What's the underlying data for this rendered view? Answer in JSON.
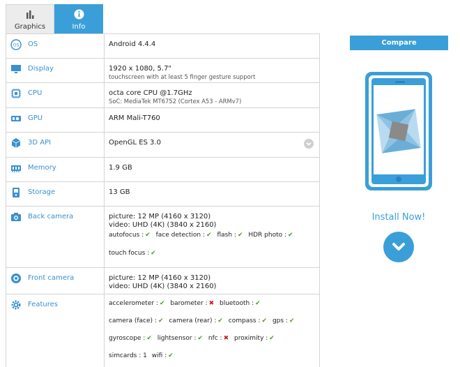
{
  "tabs": [
    {
      "label": "Graphics",
      "icon": "bar-chart-icon"
    },
    {
      "label": "Info",
      "icon": "info-icon"
    }
  ],
  "specs": {
    "os": {
      "label": "OS",
      "value": "Android 4.4.4"
    },
    "display": {
      "label": "Display",
      "value": "1920 x 1080, 5.7\"",
      "sub": "touchscreen with at least 5 finger gesture support"
    },
    "cpu": {
      "label": "CPU",
      "value": "octa core CPU @1.7GHz",
      "sub": "SoC: MediaTek MT6752 (Cortex A53 - ARMv7)"
    },
    "gpu": {
      "label": "GPU",
      "value": "ARM Mali-T760"
    },
    "api": {
      "label": "3D API",
      "value": "OpenGL ES 3.0"
    },
    "memory": {
      "label": "Memory",
      "value": "1.9 GB"
    },
    "storage": {
      "label": "Storage",
      "value": "13 GB"
    },
    "back_camera": {
      "label": "Back camera",
      "picture": "picture: 12 MP (4160 x 3120)",
      "video": "video: UHD (4K) (3840 x 2160)",
      "features": [
        "autofocus :",
        "face detection :",
        "flash :",
        "HDR photo :"
      ],
      "touch_focus": "touch focus :"
    },
    "front_camera": {
      "label": "Front camera",
      "picture": "picture: 12 MP (4160 x 3120)",
      "video": "video: UHD (4K) (3840 x 2160)"
    },
    "features": {
      "label": "Features",
      "items": [
        {
          "name": "accelerometer :",
          "ok": true
        },
        {
          "name": "barometer :",
          "ok": false
        },
        {
          "name": "bluetooth :",
          "ok": true
        },
        {
          "name": "camera (face) :",
          "ok": true
        },
        {
          "name": "camera (rear) :",
          "ok": true
        },
        {
          "name": "compass :",
          "ok": true
        },
        {
          "name": "gps :",
          "ok": true
        },
        {
          "name": "gyroscope :",
          "ok": true
        },
        {
          "name": "lightsensor :",
          "ok": true
        },
        {
          "name": "nfc :",
          "ok": false
        },
        {
          "name": "proximity :",
          "ok": true
        },
        {
          "name": "simcards : 1",
          "ok": null
        },
        {
          "name": "wifi :",
          "ok": true
        }
      ]
    }
  },
  "sidebar": {
    "compare_label": "Compare",
    "install_label": "Install Now!"
  },
  "colors": {
    "accent": "#3a9fd8",
    "label": "#3a8fd0",
    "ok": "#4a9a2a",
    "no": "#cc2222"
  }
}
